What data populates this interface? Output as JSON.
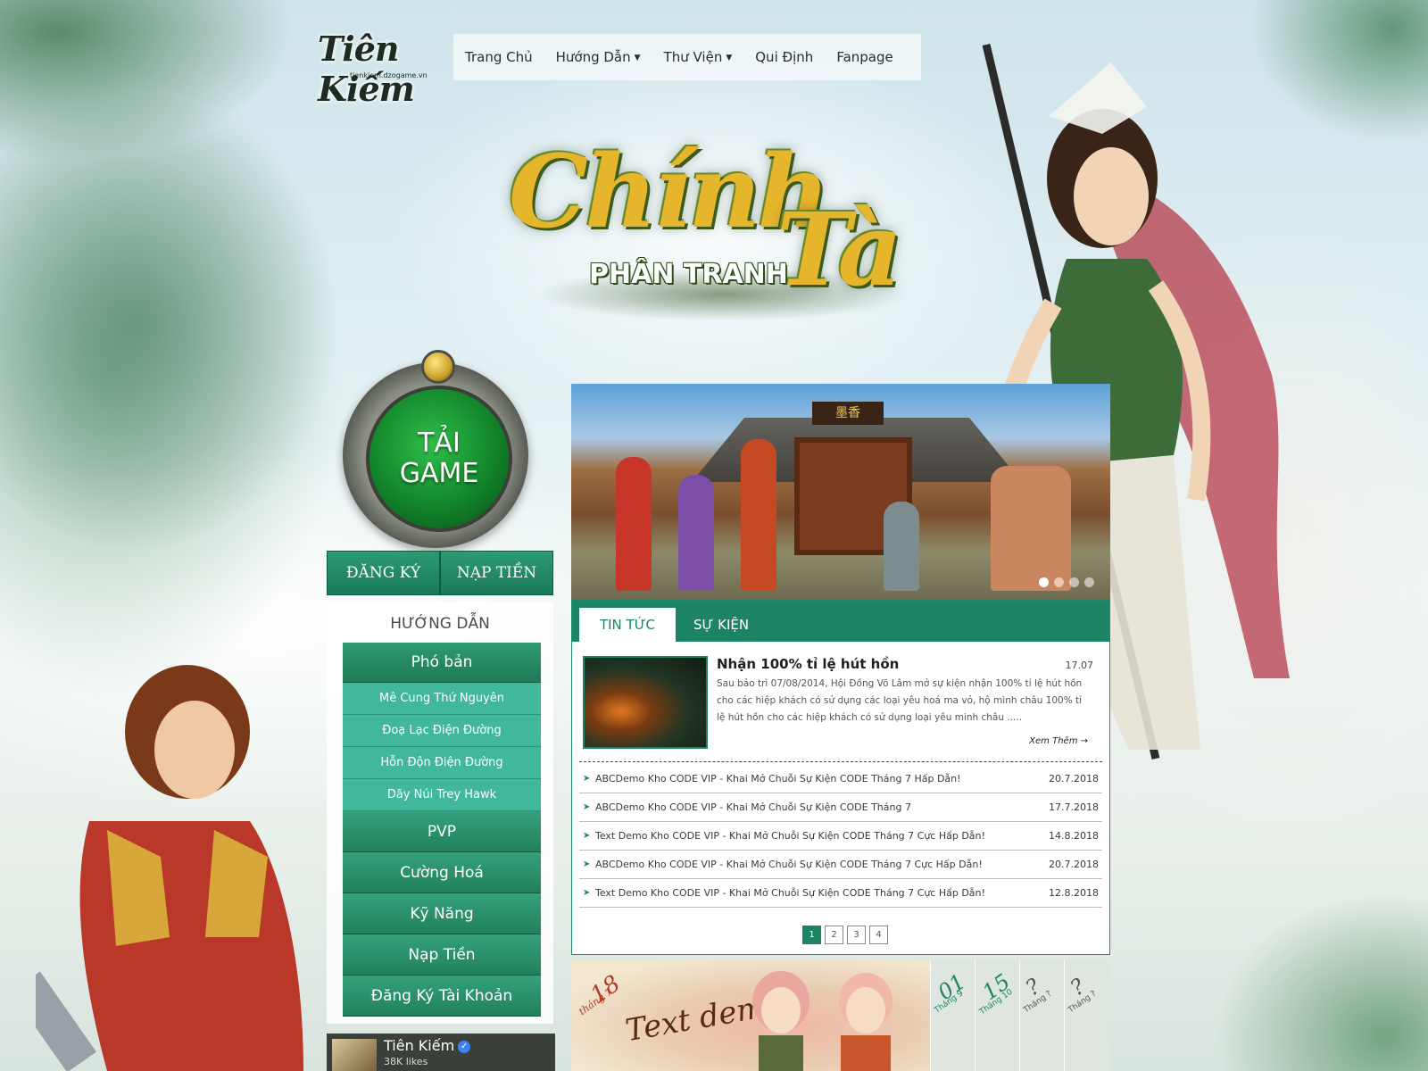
{
  "logo": {
    "title": "Tiên Kiếm",
    "subtitle": "tienkiem.dzogame.vn"
  },
  "nav": {
    "items": [
      {
        "label": "Trang Chủ",
        "has_dropdown": false
      },
      {
        "label": "Hướng Dẫn",
        "has_dropdown": true
      },
      {
        "label": "Thư Viện",
        "has_dropdown": true
      },
      {
        "label": "Qui Định",
        "has_dropdown": false
      },
      {
        "label": "Fanpage",
        "has_dropdown": false
      }
    ]
  },
  "hero_title": {
    "line1": "Chính",
    "line2": "Tà",
    "sub": "PHÂN TRANH"
  },
  "download": {
    "line1": "TẢI",
    "line2": "GAME",
    "register": "ĐĂNG KÝ",
    "topup": "NẠP TIỀN"
  },
  "guide": {
    "title": "HƯỚNG DẪN",
    "section": "Phó bản",
    "sub_items": [
      "Mê Cung Thứ Nguyên",
      "Đoạ Lạc Điện Đường",
      "Hỗn Độn Điện Đường",
      "Dãy Núi Trey Hawk"
    ],
    "main_items": [
      "PVP",
      "Cường Hoá",
      "Kỹ Năng",
      "Nạp Tiền",
      "Đăng Ký Tài Khoản"
    ]
  },
  "fanpage": {
    "name": "Tiên Kiếm",
    "likes": "38K likes"
  },
  "banner": {
    "sign": "墨香",
    "slide_count": 4,
    "active_slide": 1
  },
  "news": {
    "tabs": [
      {
        "label": "TIN TỨC",
        "active": true
      },
      {
        "label": "SỰ KIỆN",
        "active": false
      }
    ],
    "featured": {
      "title": "Nhận 100% tỉ lệ hút hồn",
      "date": "17.07",
      "desc": "Sau bảo trì 07/08/2014, Hội Đồng Võ Lâm mở sự kiện nhận 100% tỉ lệ hút hồn cho các hiệp khách có sử dụng các loại yêu hoá ma vỏ, hộ mình châu 100% tỉ lệ hút hồn cho các hiệp khách có sử dụng loại yêu minh châu .....",
      "more": "Xem Thêm →"
    },
    "items": [
      {
        "title": "ABCDemo Kho CODE VIP - Khai Mở Chuỗi Sự Kiện CODE Tháng 7 Hấp Dẫn!",
        "date": "20.7.2018"
      },
      {
        "title": "ABCDemo Kho CODE VIP - Khai Mở Chuỗi Sự Kiện CODE Tháng 7",
        "date": "17.7.2018"
      },
      {
        "title": "Text Demo Kho CODE VIP - Khai Mở Chuỗi Sự Kiện CODE Tháng 7 Cực Hấp Dẫn!",
        "date": "14.8.2018"
      },
      {
        "title": "ABCDemo Kho CODE VIP - Khai Mở Chuỗi Sự Kiện CODE Tháng 7 Cực Hấp Dẫn!",
        "date": "20.7.2018"
      },
      {
        "title": "Text Demo Kho CODE VIP - Khai Mở Chuỗi Sự Kiện CODE Tháng 7 Cực Hấp Dẫn!",
        "date": "12.8.2018"
      }
    ],
    "pages": [
      "1",
      "2",
      "3",
      "4"
    ],
    "current_page": "1"
  },
  "events": {
    "main": {
      "day": "18",
      "month": "tháng 7",
      "text": "Text demo"
    },
    "tiles": [
      {
        "day": "01",
        "month": "Tháng 9",
        "color": "#1c8464"
      },
      {
        "day": "15",
        "month": "Tháng 10",
        "color": "#1c8464"
      },
      {
        "day": "?",
        "month": "Tháng ?",
        "color": "#555555"
      },
      {
        "day": "?",
        "month": "Tháng ?",
        "color": "#555555"
      }
    ]
  },
  "colors": {
    "brand_green": "#1c8464",
    "title_gold": "#e5b52c"
  }
}
